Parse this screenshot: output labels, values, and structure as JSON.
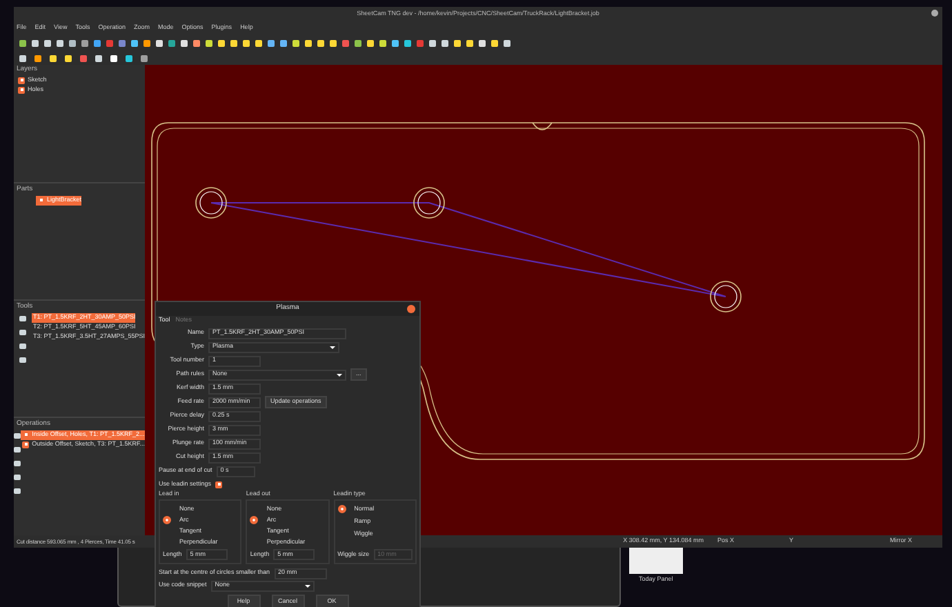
{
  "window": {
    "title": "SheetCam TNG dev - /home/kevin/Projects/CNC/SheetCam/TruckRack/LightBracket.job"
  },
  "menu": [
    "File",
    "Edit",
    "View",
    "Tools",
    "Operation",
    "Zoom",
    "Mode",
    "Options",
    "Plugins",
    "Help"
  ],
  "layers": {
    "title": "Layers",
    "items": [
      {
        "label": "Sketch",
        "checked": true
      },
      {
        "label": "Holes",
        "checked": true
      }
    ]
  },
  "parts": {
    "title": "Parts",
    "items": [
      {
        "label": "LightBracket",
        "checked": true,
        "selected": true
      }
    ]
  },
  "tools": {
    "title": "Tools",
    "items": [
      {
        "label": "T1: PT_1.5KRF_2HT_30AMP_50PSI",
        "selected": true
      },
      {
        "label": "T2: PT_1.5KRF_5HT_45AMP_60PSI",
        "selected": false
      },
      {
        "label": "T3: PT_1.5KRF_3.5HT_27AMPS_55PSI",
        "selected": false
      }
    ]
  },
  "operations": {
    "title": "Operations",
    "items": [
      {
        "label": "Inside Offset, Holes, T1: PT_1.5KRF_2...",
        "checked": true,
        "selected": true
      },
      {
        "label": "Outside Offset, Sketch, T3: PT_1.5KRF...",
        "checked": true,
        "selected": false
      }
    ]
  },
  "status_bar": {
    "summary": "Cut distance 593.065 mm , 4 Pierces, Time 41.05 s",
    "position": "X 308.42 mm, Y 134.084 mm",
    "pos_x": "Pos X",
    "y": "Y",
    "mirror": "Mirror X"
  },
  "dialog": {
    "title": "Plasma",
    "tabs": [
      {
        "label": "Tool",
        "selected": true
      },
      {
        "label": "Notes",
        "selected": false
      }
    ],
    "fields": [
      {
        "label": "Name",
        "kind": "wide",
        "value": "PT_1.5KRF_2HT_30AMP_50PSI"
      },
      {
        "label": "Type",
        "kind": "select",
        "value": "Plasma"
      },
      {
        "label": "Tool number",
        "kind": "text",
        "value": "1"
      },
      {
        "label": "Path rules",
        "kind": "select",
        "value": "None",
        "button": "..."
      },
      {
        "label": "Kerf width",
        "kind": "text",
        "value": "1.5 mm"
      },
      {
        "label": "Feed rate",
        "kind": "text",
        "value": "2000 mm/min",
        "button": "Update operations"
      },
      {
        "label": "Pierce delay",
        "kind": "text",
        "value": "0.25 s"
      },
      {
        "label": "Pierce height",
        "kind": "text",
        "value": "3 mm"
      },
      {
        "label": "Plunge rate",
        "kind": "text",
        "value": "100 mm/min"
      },
      {
        "label": "Cut height",
        "kind": "text",
        "value": "1.5 mm"
      }
    ],
    "pause": {
      "label": "Pause at end of cut",
      "value": "0 s"
    },
    "use_leadin": {
      "label": "Use leadin settings",
      "checked": true
    },
    "lead_in": {
      "title": "Lead in",
      "options": [
        {
          "label": "None",
          "selected": false
        },
        {
          "label": "Arc",
          "selected": true
        },
        {
          "label": "Tangent",
          "selected": false
        },
        {
          "label": "Perpendicular",
          "selected": false
        }
      ],
      "length_label": "Length",
      "length": "5 mm"
    },
    "lead_out": {
      "title": "Lead out",
      "options": [
        {
          "label": "None",
          "selected": false
        },
        {
          "label": "Arc",
          "selected": true
        },
        {
          "label": "Tangent",
          "selected": false
        },
        {
          "label": "Perpendicular",
          "selected": false
        }
      ],
      "length_label": "Length",
      "length": "5 mm"
    },
    "leadin_type": {
      "title": "Leadin type",
      "options": [
        {
          "label": "Normal",
          "selected": true
        },
        {
          "label": "Ramp",
          "selected": false
        },
        {
          "label": "Wiggle",
          "selected": false
        }
      ],
      "wiggle_label": "Wiggle size",
      "wiggle": "10 mm",
      "wiggle_disabled": true
    },
    "centre": {
      "label": "Start at the centre of circles smaller than",
      "value": "20 mm"
    },
    "snippet": {
      "label": "Use code snippet",
      "value": "None"
    },
    "buttons": [
      "Help",
      "Cancel",
      "OK"
    ]
  },
  "taskbar": {
    "label": "Today Panel"
  }
}
